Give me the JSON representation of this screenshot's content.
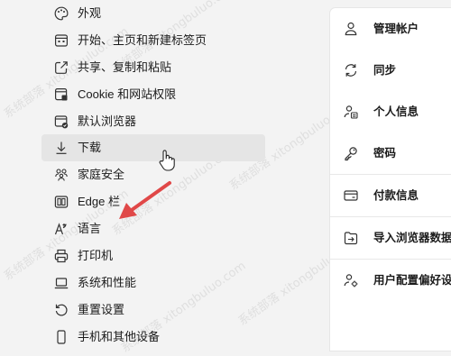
{
  "sidebar": {
    "items": [
      {
        "label": "外观",
        "icon": "palette-icon"
      },
      {
        "label": "开始、主页和新建标签页",
        "icon": "new-tab-icon"
      },
      {
        "label": "共享、复制和粘贴",
        "icon": "share-icon"
      },
      {
        "label": "Cookie 和网站权限",
        "icon": "site-permissions-icon"
      },
      {
        "label": "默认浏览器",
        "icon": "default-browser-icon"
      },
      {
        "label": "下载",
        "icon": "download-icon"
      },
      {
        "label": "家庭安全",
        "icon": "family-icon"
      },
      {
        "label": "Edge 栏",
        "icon": "edge-bar-icon"
      },
      {
        "label": "语言",
        "icon": "language-icon"
      },
      {
        "label": "打印机",
        "icon": "printer-icon"
      },
      {
        "label": "系统和性能",
        "icon": "laptop-icon"
      },
      {
        "label": "重置设置",
        "icon": "reset-icon"
      },
      {
        "label": "手机和其他设备",
        "icon": "phone-icon"
      }
    ],
    "hovered_index": 5
  },
  "profile_panel": {
    "rows": [
      {
        "label": "管理帐户",
        "icon": "person-icon"
      },
      {
        "label": "同步",
        "icon": "sync-icon"
      },
      {
        "label": "个人信息",
        "icon": "personal-info-icon"
      },
      {
        "label": "密码",
        "icon": "key-icon"
      },
      {
        "label": "付款信息",
        "icon": "card-icon"
      },
      {
        "label": "导入浏览器数据",
        "icon": "import-icon"
      },
      {
        "label": "用户配置偏好设置",
        "icon": "profile-prefs-icon"
      }
    ]
  },
  "annotation": {
    "arrow_color": "#e04848"
  },
  "watermark": {
    "text": "系统部落 xitongbuluo.com"
  },
  "colors": {
    "hover_bg": "#e5e5e5",
    "panel_bg": "#ffffff",
    "page_bg": "#f3f3f3"
  }
}
